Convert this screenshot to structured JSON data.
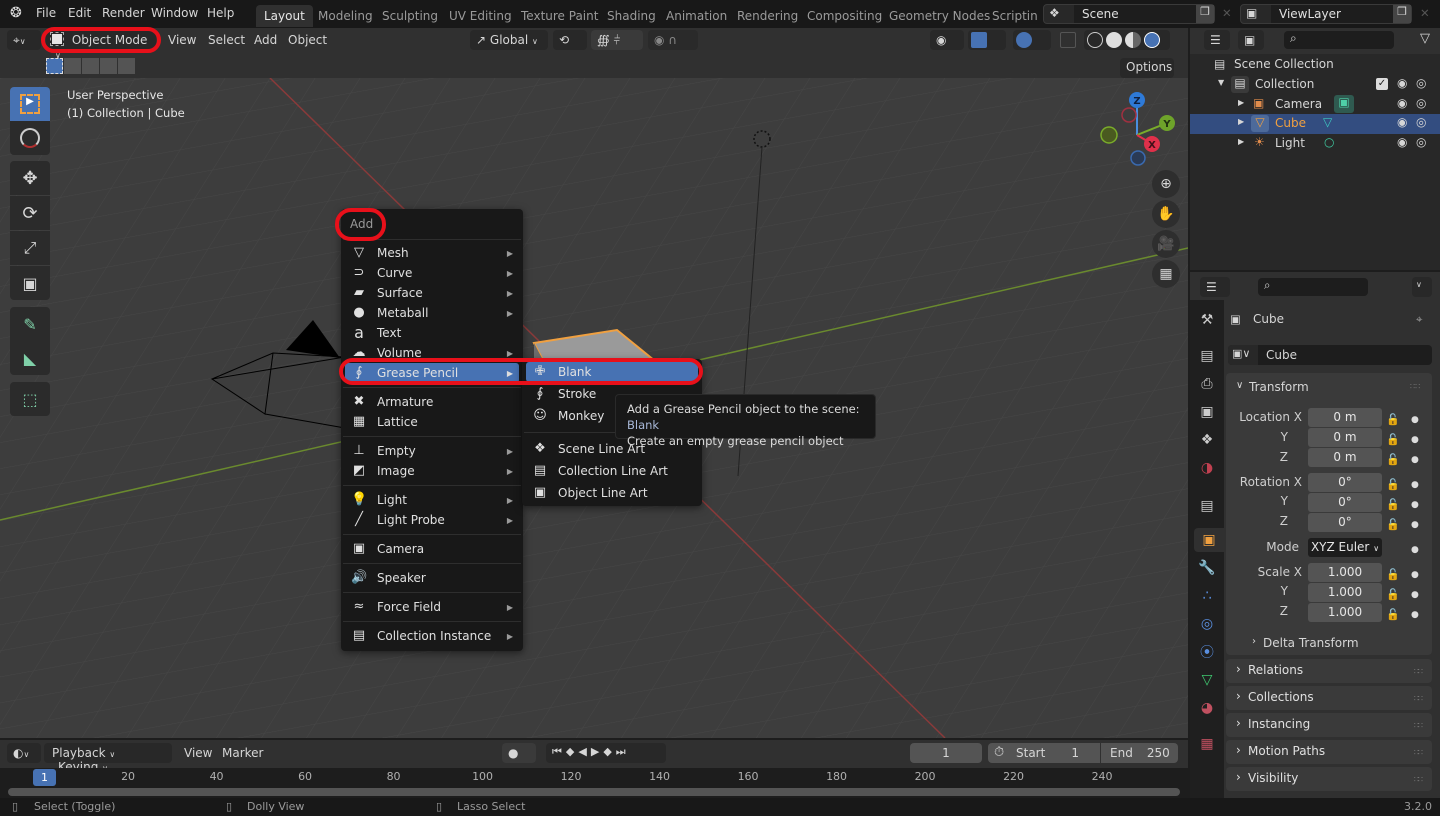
{
  "topbar": {
    "menus": [
      "File",
      "Edit",
      "Render",
      "Window",
      "Help"
    ],
    "workspaces": [
      "Layout",
      "Modeling",
      "Sculpting",
      "UV Editing",
      "Texture Paint",
      "Shading",
      "Animation",
      "Rendering",
      "Compositing",
      "Geometry Nodes",
      "Scripting"
    ],
    "active_workspace": "Layout",
    "scene": "Scene",
    "view_layer": "ViewLayer"
  },
  "header": {
    "mode": "Object Mode",
    "menus": [
      "View",
      "Select",
      "Add",
      "Object"
    ],
    "orientation": "Global",
    "options": "Options"
  },
  "viewport": {
    "perspective": "User Perspective",
    "context": "(1) Collection | Cube",
    "gizmo_axes": [
      "Z",
      "Y",
      "X"
    ]
  },
  "add_menu": {
    "title": "Add",
    "items": [
      {
        "label": "Mesh",
        "icon": "mesh-icon",
        "submenu": true
      },
      {
        "label": "Curve",
        "icon": "curve-icon",
        "submenu": true
      },
      {
        "label": "Surface",
        "icon": "surface-icon",
        "submenu": true
      },
      {
        "label": "Metaball",
        "icon": "metaball-icon",
        "submenu": true
      },
      {
        "label": "Text",
        "icon": "text-icon",
        "submenu": false
      },
      {
        "label": "Volume",
        "icon": "volume-icon",
        "submenu": true
      },
      {
        "label": "Grease Pencil",
        "icon": "grease-pencil-icon",
        "submenu": true,
        "active": true
      },
      {
        "label": "Armature",
        "icon": "armature-icon",
        "submenu": false
      },
      {
        "label": "Lattice",
        "icon": "lattice-icon",
        "submenu": false
      },
      {
        "label": "Empty",
        "icon": "empty-icon",
        "submenu": true
      },
      {
        "label": "Image",
        "icon": "image-icon",
        "submenu": true
      },
      {
        "label": "Light",
        "icon": "light-icon",
        "submenu": true
      },
      {
        "label": "Light Probe",
        "icon": "light-probe-icon",
        "submenu": true
      },
      {
        "label": "Camera",
        "icon": "camera-icon",
        "submenu": false
      },
      {
        "label": "Speaker",
        "icon": "speaker-icon",
        "submenu": false
      },
      {
        "label": "Force Field",
        "icon": "force-field-icon",
        "submenu": true
      },
      {
        "label": "Collection Instance",
        "icon": "collection-instance-icon",
        "submenu": true
      }
    ]
  },
  "grease_pencil_submenu": {
    "items": [
      {
        "label": "Blank",
        "icon": "blank-icon",
        "active": true
      },
      {
        "label": "Stroke",
        "icon": "stroke-icon"
      },
      {
        "label": "Monkey",
        "icon": "monkey-icon"
      },
      {
        "label": "Scene Line Art",
        "icon": "scene-icon"
      },
      {
        "label": "Collection Line Art",
        "icon": "collection-icon"
      },
      {
        "label": "Object Line Art",
        "icon": "object-icon"
      }
    ]
  },
  "tooltip": {
    "line1": "Add a Grease Pencil object to the scene:",
    "line1_value": "Blank",
    "line2": "Create an empty grease pencil object"
  },
  "outliner": {
    "items": [
      {
        "label": "Scene Collection"
      },
      {
        "label": "Collection"
      },
      {
        "label": "Camera"
      },
      {
        "label": "Cube",
        "selected": true
      },
      {
        "label": "Light"
      }
    ]
  },
  "properties": {
    "object_name": "Cube",
    "data_name": "Cube",
    "transform_title": "Transform",
    "location": {
      "label": "Location X",
      "x": "0 m",
      "y": "0 m",
      "z": "0 m"
    },
    "rotation": {
      "label": "Rotation X",
      "x": "0°",
      "y": "0°",
      "z": "0°"
    },
    "mode_label": "Mode",
    "mode_value": "XYZ Euler",
    "scale": {
      "label": "Scale X",
      "x": "1.000",
      "y": "1.000",
      "z": "1.000"
    },
    "axis_labels": [
      "Y",
      "Z"
    ],
    "delta": "Delta Transform",
    "panels": [
      "Relations",
      "Collections",
      "Instancing",
      "Motion Paths",
      "Visibility"
    ]
  },
  "timeline": {
    "menus": [
      "Playback",
      "Keying",
      "View",
      "Marker"
    ],
    "current_frame": "1",
    "start_label": "Start",
    "start": "1",
    "end_label": "End",
    "end": "250",
    "ruler": [
      "20",
      "40",
      "60",
      "80",
      "100",
      "120",
      "140",
      "160",
      "180",
      "200",
      "220",
      "240"
    ],
    "cursor_frame": "1"
  },
  "statusbar": {
    "hints": [
      "Select (Toggle)",
      "Dolly View",
      "Lasso Select"
    ],
    "version": "3.2.0"
  },
  "colors": {
    "accent": "#4772b3",
    "highlight_ring": "#e8101a",
    "selected_orange": "#f0a040"
  }
}
